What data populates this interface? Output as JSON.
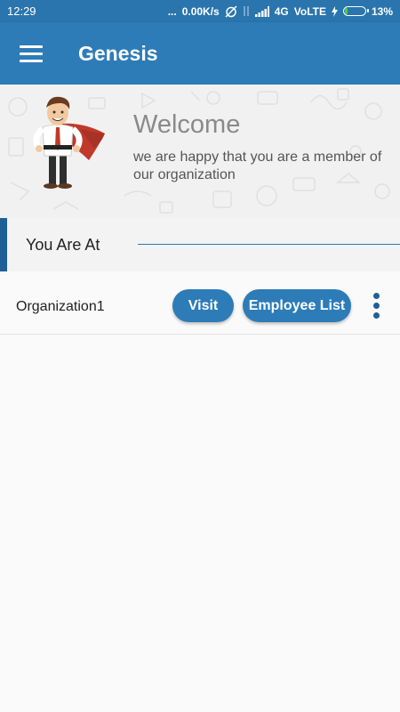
{
  "status_bar": {
    "time": "12:29",
    "dots": "...",
    "speed": "0.00K/s",
    "network": "4G",
    "volte": "VoLTE",
    "battery": "13%",
    "battery_level": 0.13
  },
  "app_bar": {
    "title": "Genesis"
  },
  "welcome": {
    "title": "Welcome",
    "message": "we are happy that you are a member of our organization"
  },
  "location_section": {
    "label": "You Are At"
  },
  "organizations": [
    {
      "name": "Organization1",
      "visit_label": "Visit",
      "employee_list_label": "Employee List"
    }
  ],
  "colors": {
    "primary": "#2d7cb8",
    "primary_dark": "#2a75ad",
    "accent_dark": "#1e5f96"
  }
}
